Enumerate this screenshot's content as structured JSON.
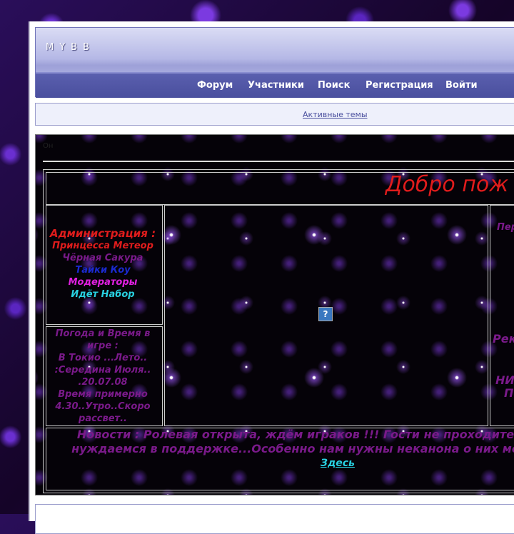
{
  "header": {
    "logo": "MYBB"
  },
  "nav": {
    "items": [
      {
        "label": "Форум"
      },
      {
        "label": "Участники"
      },
      {
        "label": "Поиск"
      },
      {
        "label": "Регистрация"
      },
      {
        "label": "Войти"
      }
    ]
  },
  "subbar": {
    "active_topics": "Активные темы"
  },
  "content": {
    "small_text": "Он",
    "welcome": "Добро пож",
    "admin": {
      "title": "Администрация :",
      "lines": [
        {
          "text": "Принцесса Метеор",
          "color": "#e01c1c"
        },
        {
          "text": "Чёрная Сакура",
          "color": "#7a1a8a"
        },
        {
          "text": "Тайки Коу",
          "color": "#1a2ad0"
        },
        {
          "text": "Модераторы",
          "color": "#e020e0"
        },
        {
          "text": "Идёт Набор",
          "color": "#28d0e0"
        }
      ]
    },
    "weather": [
      "Погода и Время в",
      "игре :",
      "В Токио ...Лето..",
      ":Середина Июля..",
      ".20.07.08",
      "Время примерно",
      "4.30..Утро..Скоро",
      "рассвет.."
    ],
    "right": {
      "per": "Пер",
      "rek": "Рек",
      "ni": "НИ",
      "p": "П"
    },
    "news": {
      "line1": "Новости : Ролевая открыта, ждём играков !!! Гости не проходите",
      "line2": "нуждаемся в поддержке...Особенно нам нужны неканона о них мо",
      "link": "Здесь"
    }
  },
  "colors": {
    "accent": "#4a4f9e",
    "welcome": "#e01c1c",
    "text_purple": "#7a1a8a",
    "link_cyan": "#28d0e0"
  },
  "icons": {
    "broken_image": "question-icon"
  }
}
